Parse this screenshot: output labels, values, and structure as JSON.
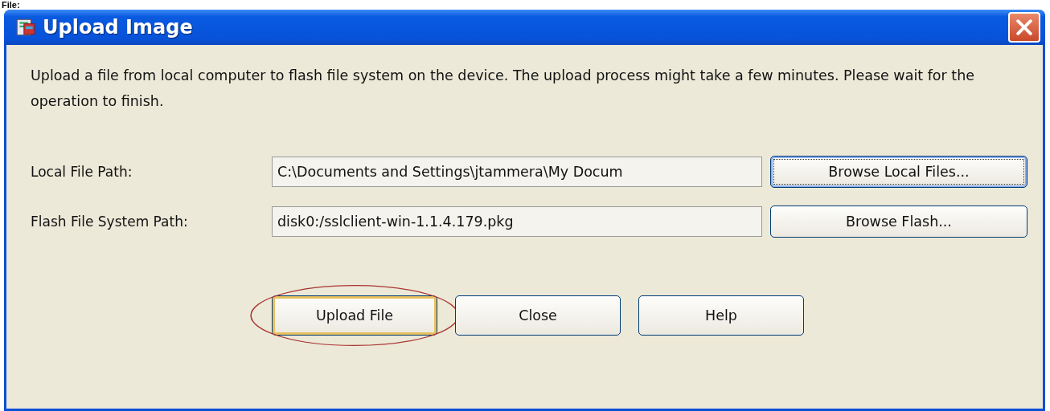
{
  "caption": "File:",
  "window": {
    "title": "Upload Image"
  },
  "description": "Upload a file from local computer to flash file system on the device. The upload process might take a few minutes. Please wait for the operation to finish.",
  "fields": [
    {
      "label": "Local File Path:",
      "value": "C:\\Documents and Settings\\jtammera\\My Docum",
      "button": {
        "label": "Browse Local Files...",
        "focused": true
      }
    },
    {
      "label": "Flash File System Path:",
      "value": "disk0:/sslclient-win-1.1.4.179.pkg",
      "button": {
        "label": "Browse Flash...",
        "focused": false
      }
    }
  ],
  "buttons": [
    {
      "label": "Upload File",
      "default": true,
      "highlighted": true
    },
    {
      "label": "Close",
      "default": false,
      "highlighted": false
    },
    {
      "label": "Help",
      "default": false,
      "highlighted": false
    }
  ]
}
